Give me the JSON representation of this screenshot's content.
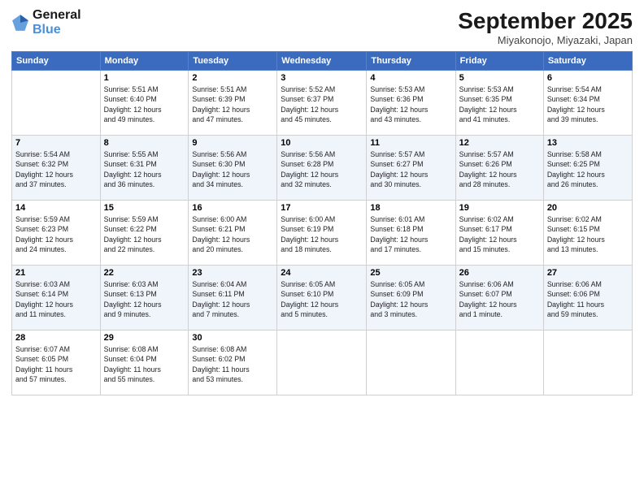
{
  "header": {
    "logo_line1": "General",
    "logo_line2": "Blue",
    "month_title": "September 2025",
    "location": "Miyakonojo, Miyazaki, Japan"
  },
  "days_of_week": [
    "Sunday",
    "Monday",
    "Tuesday",
    "Wednesday",
    "Thursday",
    "Friday",
    "Saturday"
  ],
  "weeks": [
    [
      {
        "day": "",
        "info": ""
      },
      {
        "day": "1",
        "info": "Sunrise: 5:51 AM\nSunset: 6:40 PM\nDaylight: 12 hours\nand 49 minutes."
      },
      {
        "day": "2",
        "info": "Sunrise: 5:51 AM\nSunset: 6:39 PM\nDaylight: 12 hours\nand 47 minutes."
      },
      {
        "day": "3",
        "info": "Sunrise: 5:52 AM\nSunset: 6:37 PM\nDaylight: 12 hours\nand 45 minutes."
      },
      {
        "day": "4",
        "info": "Sunrise: 5:53 AM\nSunset: 6:36 PM\nDaylight: 12 hours\nand 43 minutes."
      },
      {
        "day": "5",
        "info": "Sunrise: 5:53 AM\nSunset: 6:35 PM\nDaylight: 12 hours\nand 41 minutes."
      },
      {
        "day": "6",
        "info": "Sunrise: 5:54 AM\nSunset: 6:34 PM\nDaylight: 12 hours\nand 39 minutes."
      }
    ],
    [
      {
        "day": "7",
        "info": "Sunrise: 5:54 AM\nSunset: 6:32 PM\nDaylight: 12 hours\nand 37 minutes."
      },
      {
        "day": "8",
        "info": "Sunrise: 5:55 AM\nSunset: 6:31 PM\nDaylight: 12 hours\nand 36 minutes."
      },
      {
        "day": "9",
        "info": "Sunrise: 5:56 AM\nSunset: 6:30 PM\nDaylight: 12 hours\nand 34 minutes."
      },
      {
        "day": "10",
        "info": "Sunrise: 5:56 AM\nSunset: 6:28 PM\nDaylight: 12 hours\nand 32 minutes."
      },
      {
        "day": "11",
        "info": "Sunrise: 5:57 AM\nSunset: 6:27 PM\nDaylight: 12 hours\nand 30 minutes."
      },
      {
        "day": "12",
        "info": "Sunrise: 5:57 AM\nSunset: 6:26 PM\nDaylight: 12 hours\nand 28 minutes."
      },
      {
        "day": "13",
        "info": "Sunrise: 5:58 AM\nSunset: 6:25 PM\nDaylight: 12 hours\nand 26 minutes."
      }
    ],
    [
      {
        "day": "14",
        "info": "Sunrise: 5:59 AM\nSunset: 6:23 PM\nDaylight: 12 hours\nand 24 minutes."
      },
      {
        "day": "15",
        "info": "Sunrise: 5:59 AM\nSunset: 6:22 PM\nDaylight: 12 hours\nand 22 minutes."
      },
      {
        "day": "16",
        "info": "Sunrise: 6:00 AM\nSunset: 6:21 PM\nDaylight: 12 hours\nand 20 minutes."
      },
      {
        "day": "17",
        "info": "Sunrise: 6:00 AM\nSunset: 6:19 PM\nDaylight: 12 hours\nand 18 minutes."
      },
      {
        "day": "18",
        "info": "Sunrise: 6:01 AM\nSunset: 6:18 PM\nDaylight: 12 hours\nand 17 minutes."
      },
      {
        "day": "19",
        "info": "Sunrise: 6:02 AM\nSunset: 6:17 PM\nDaylight: 12 hours\nand 15 minutes."
      },
      {
        "day": "20",
        "info": "Sunrise: 6:02 AM\nSunset: 6:15 PM\nDaylight: 12 hours\nand 13 minutes."
      }
    ],
    [
      {
        "day": "21",
        "info": "Sunrise: 6:03 AM\nSunset: 6:14 PM\nDaylight: 12 hours\nand 11 minutes."
      },
      {
        "day": "22",
        "info": "Sunrise: 6:03 AM\nSunset: 6:13 PM\nDaylight: 12 hours\nand 9 minutes."
      },
      {
        "day": "23",
        "info": "Sunrise: 6:04 AM\nSunset: 6:11 PM\nDaylight: 12 hours\nand 7 minutes."
      },
      {
        "day": "24",
        "info": "Sunrise: 6:05 AM\nSunset: 6:10 PM\nDaylight: 12 hours\nand 5 minutes."
      },
      {
        "day": "25",
        "info": "Sunrise: 6:05 AM\nSunset: 6:09 PM\nDaylight: 12 hours\nand 3 minutes."
      },
      {
        "day": "26",
        "info": "Sunrise: 6:06 AM\nSunset: 6:07 PM\nDaylight: 12 hours\nand 1 minute."
      },
      {
        "day": "27",
        "info": "Sunrise: 6:06 AM\nSunset: 6:06 PM\nDaylight: 11 hours\nand 59 minutes."
      }
    ],
    [
      {
        "day": "28",
        "info": "Sunrise: 6:07 AM\nSunset: 6:05 PM\nDaylight: 11 hours\nand 57 minutes."
      },
      {
        "day": "29",
        "info": "Sunrise: 6:08 AM\nSunset: 6:04 PM\nDaylight: 11 hours\nand 55 minutes."
      },
      {
        "day": "30",
        "info": "Sunrise: 6:08 AM\nSunset: 6:02 PM\nDaylight: 11 hours\nand 53 minutes."
      },
      {
        "day": "",
        "info": ""
      },
      {
        "day": "",
        "info": ""
      },
      {
        "day": "",
        "info": ""
      },
      {
        "day": "",
        "info": ""
      }
    ]
  ]
}
